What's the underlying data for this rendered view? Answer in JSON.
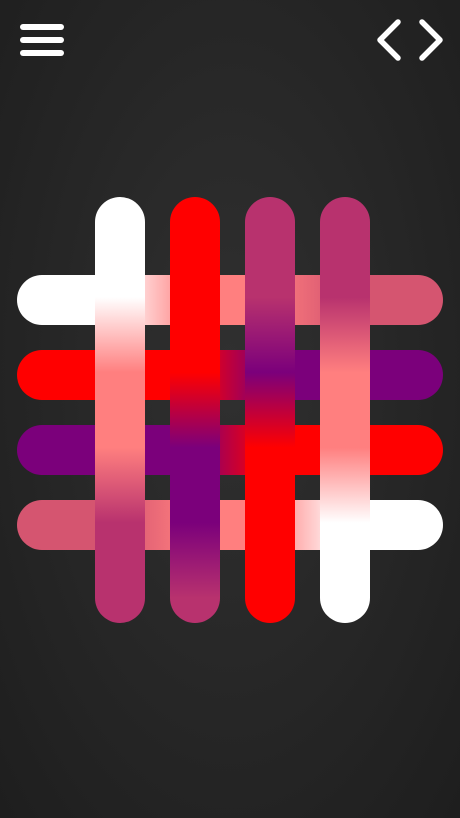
{
  "toolbar": {
    "menu_icon": "hamburger-menu-icon",
    "prev_icon": "chevron-left-icon",
    "next_icon": "chevron-right-icon"
  },
  "colors": {
    "background": "#262626",
    "white": "#ffffff",
    "red": "#ff0000",
    "purple": "#7b007b",
    "magenta": "#b8326e",
    "rose": "#d55570",
    "pink": "#ff7a7a"
  },
  "puzzle": {
    "type": "color-weave",
    "grid": "4x4",
    "vertical_strands": [
      {
        "id": "col-1",
        "colors": [
          "#ffffff",
          "#ffffff",
          "#ff7f7f",
          "#ff7f7f",
          "#b8326e",
          "#b8326e"
        ]
      },
      {
        "id": "col-2",
        "colors": [
          "#ff0000",
          "#ff0000",
          "#ff0000",
          "#7b007b",
          "#7b007b",
          "#b8326e"
        ]
      },
      {
        "id": "col-3",
        "colors": [
          "#b8326e",
          "#b8326e",
          "#7b007b",
          "#ff0000",
          "#ff0000",
          "#ff0000"
        ]
      },
      {
        "id": "col-4",
        "colors": [
          "#b8326e",
          "#b8326e",
          "#ff7f7f",
          "#ff7f7f",
          "#ffffff",
          "#ffffff"
        ]
      }
    ],
    "horizontal_strands": [
      {
        "id": "row-1",
        "colors": [
          "#ffffff",
          "#ffffff",
          "#ff7f7f",
          "#ff7f7f",
          "#d55570",
          "#d55570"
        ]
      },
      {
        "id": "row-2",
        "colors": [
          "#ff0000",
          "#ff0000",
          "#ff0000",
          "#7b007b",
          "#7b007b",
          "#7b007b"
        ]
      },
      {
        "id": "row-3",
        "colors": [
          "#7b007b",
          "#7b007b",
          "#7b007b",
          "#ff0000",
          "#ff0000",
          "#ff0000"
        ]
      },
      {
        "id": "row-4",
        "colors": [
          "#d55570",
          "#d55570",
          "#ff7f7f",
          "#ff7f7f",
          "#ffffff",
          "#ffffff"
        ]
      }
    ]
  }
}
